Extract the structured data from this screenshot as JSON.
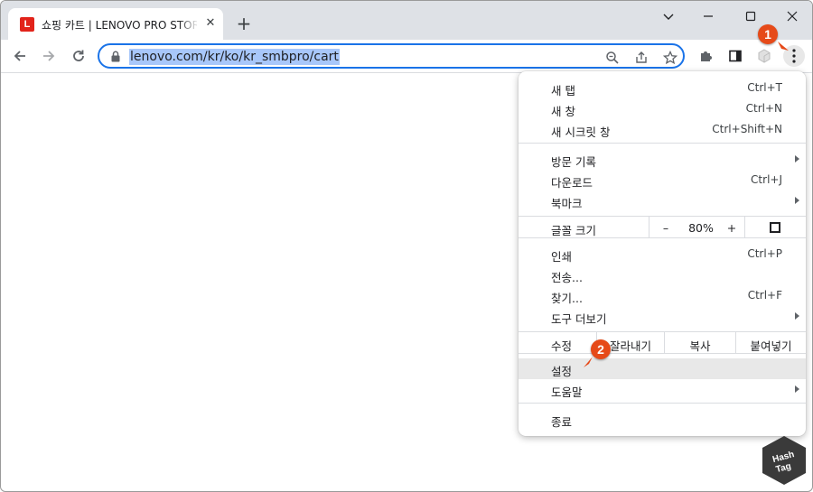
{
  "tab": {
    "favicon_letter": "L",
    "title": "쇼핑 카트 | LENOVO PRO STORE",
    "close": "✕"
  },
  "new_tab": "+",
  "window": {
    "minimize": "–",
    "maximize": "□",
    "close": "✕",
    "dropdown": "⌄"
  },
  "address": {
    "url": "lenovo.com/kr/ko/kr_smbpro/cart"
  },
  "callouts": {
    "one": "1",
    "two": "2"
  },
  "menu": {
    "group1": [
      {
        "label": "새 탭",
        "shortcut": "Ctrl+T"
      },
      {
        "label": "새 창",
        "shortcut": "Ctrl+N"
      },
      {
        "label": "새 시크릿 창",
        "shortcut": "Ctrl+Shift+N"
      }
    ],
    "group2": [
      {
        "label": "방문 기록",
        "shortcut": ""
      },
      {
        "label": "다운로드",
        "shortcut": "Ctrl+J"
      },
      {
        "label": "북마크",
        "shortcut": ""
      }
    ],
    "zoom": {
      "label": "글꼴 크기",
      "minus": "–",
      "value": "80%",
      "plus": "+"
    },
    "group3": [
      {
        "label": "인쇄",
        "shortcut": "Ctrl+P"
      },
      {
        "label": "전송...",
        "shortcut": ""
      },
      {
        "label": "찾기...",
        "shortcut": "Ctrl+F"
      },
      {
        "label": "도구 더보기",
        "shortcut": ""
      }
    ],
    "edit": {
      "label": "수정",
      "cut": "잘라내기",
      "copy": "복사",
      "paste": "붙여넣기"
    },
    "settings": "설정",
    "help": "도움말",
    "exit": "종료"
  },
  "watermark": {
    "line1": "Hash",
    "line2": "Tag"
  },
  "colors": {
    "accent": "#1a73e8",
    "badge": "#e64a19",
    "favicon": "#e2231a"
  }
}
